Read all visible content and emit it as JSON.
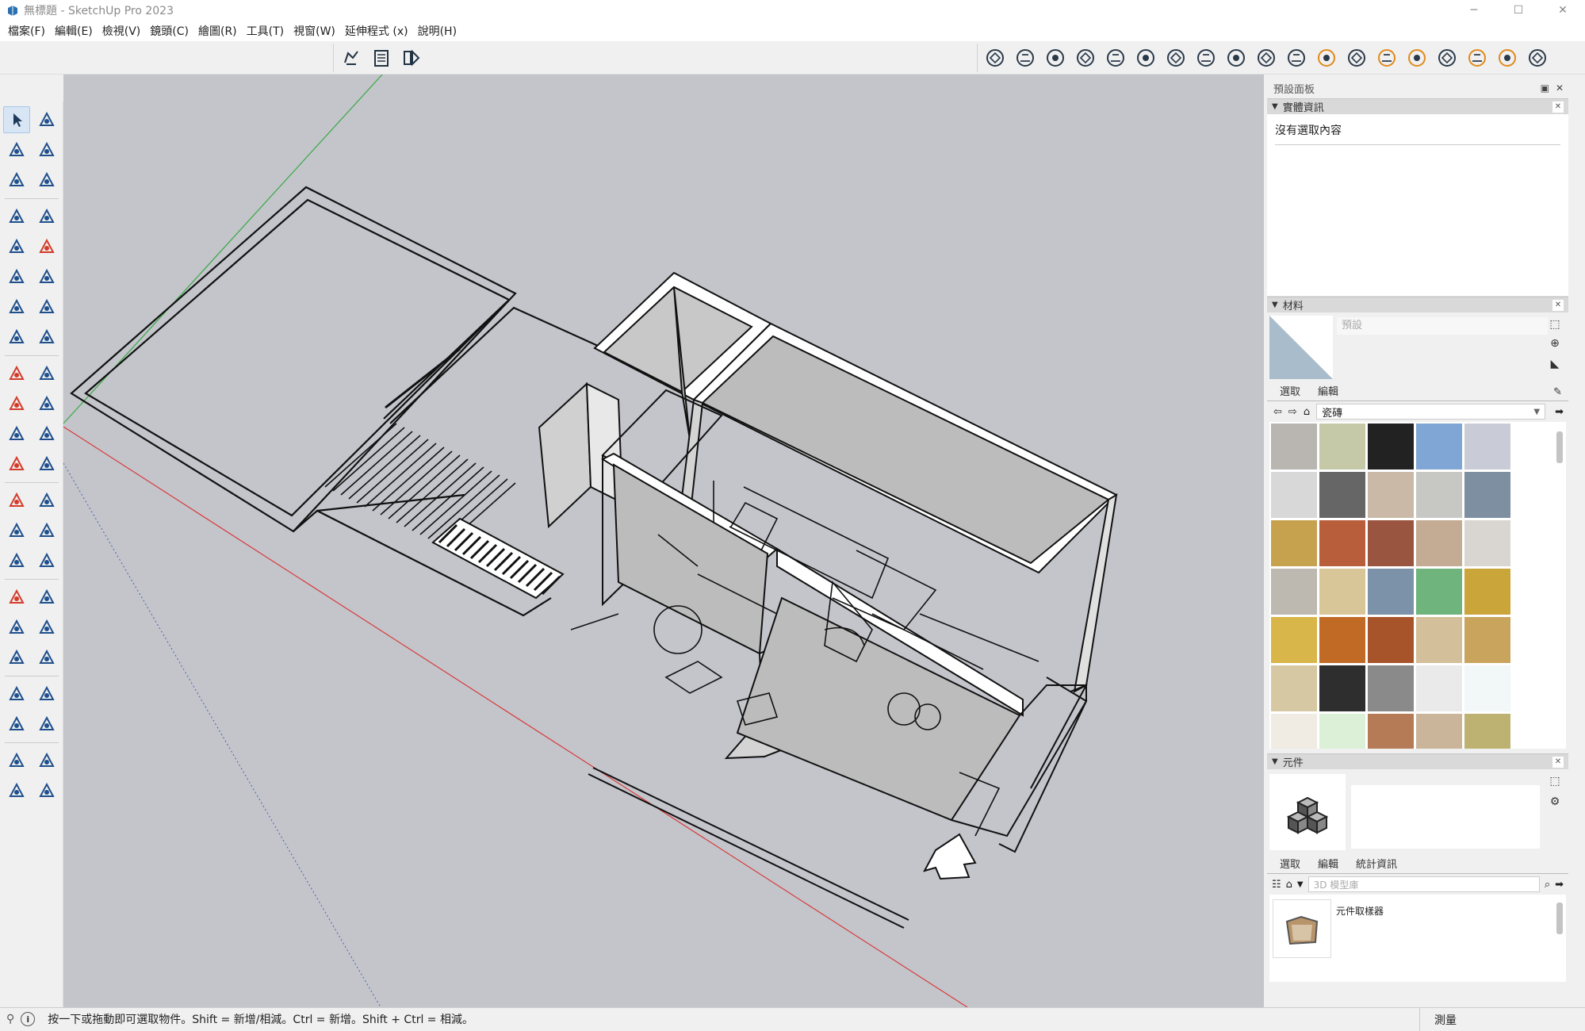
{
  "window": {
    "title": "無標題 - SketchUp Pro 2023",
    "minimize_icon": "─",
    "maximize_icon": "☐",
    "close_icon": "✕"
  },
  "menu": {
    "items": [
      "檔案(F)",
      "編輯(E)",
      "檢視(V)",
      "鏡頭(C)",
      "繪圖(R)",
      "工具(T)",
      "視窗(W)",
      "延伸程式 (x)",
      "說明(H)"
    ]
  },
  "toolbar": {
    "group1_icons": [
      "sandbox-icon",
      "outliner-icon",
      "scenes-icon"
    ],
    "group2_icons": [
      "trimble-connect-icon",
      "extension-warehouse-icon",
      "teapot-icon",
      "teapot-play-icon",
      "sphere-icon",
      "wave-icon",
      "rotate-icon",
      "stamp-icon",
      "section-box-icon",
      "frame-icon",
      "lock-icon",
      "settings-light-icon",
      "umbrella-icon",
      "disc-icon",
      "angle-icon",
      "t-icon",
      "sun-icon",
      "hat-icon",
      "cube-icon"
    ]
  },
  "tray": {
    "title": "預設面板",
    "entity_info": {
      "header": "實體資訊",
      "text": "沒有選取內容"
    },
    "materials": {
      "header": "材料",
      "name_placeholder": "預設",
      "tabs": [
        "選取",
        "編輯"
      ],
      "library": "瓷磚"
    },
    "components": {
      "header": "元件",
      "tabs": [
        "選取",
        "編輯",
        "統計資訊"
      ],
      "search_placeholder": "3D 模型庫",
      "list_item": "元件取樣器"
    }
  },
  "statusbar": {
    "info_icon": "i",
    "text": "按一下或拖動即可選取物件。Shift = 新增/相減。Ctrl = 新增。Shift + Ctrl = 相減。",
    "measure_label": "測量"
  },
  "colors": {
    "viewport": "#c3c5cb",
    "axis_red": "#d83a3a",
    "axis_green": "#3aa843",
    "axis_blue": "#4a60b8"
  }
}
